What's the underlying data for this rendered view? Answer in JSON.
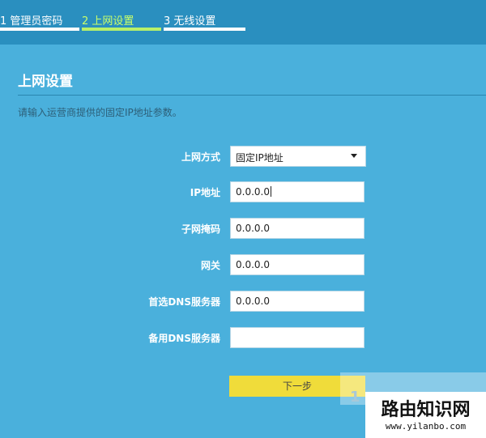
{
  "steps": [
    {
      "label": "1 管理员密码"
    },
    {
      "label": "2 上网设置"
    },
    {
      "label": "3 无线设置"
    }
  ],
  "page": {
    "title": "上网设置",
    "subtitle": "请输入运营商提供的固定IP地址参数。"
  },
  "form": {
    "connection_type": {
      "label": "上网方式",
      "value": "固定IP地址"
    },
    "ip": {
      "label": "IP地址",
      "value": "0.0.0.0"
    },
    "subnet": {
      "label": "子网掩码",
      "value": "0.0.0.0"
    },
    "gateway": {
      "label": "网关",
      "value": "0.0.0.0"
    },
    "dns_primary": {
      "label": "首选DNS服务器",
      "value": "0.0.0.0"
    },
    "dns_secondary": {
      "label": "备用DNS服务器",
      "value": ""
    }
  },
  "next_button": "下一步",
  "watermark": {
    "title": "路由知识网",
    "url": "www.yilanbo.com",
    "partial_text": "1"
  },
  "colors": {
    "background": "#4ab0dc",
    "topbar": "#2a8fbf",
    "active_step": "#c8ff6a",
    "button": "#f0dc3a"
  }
}
